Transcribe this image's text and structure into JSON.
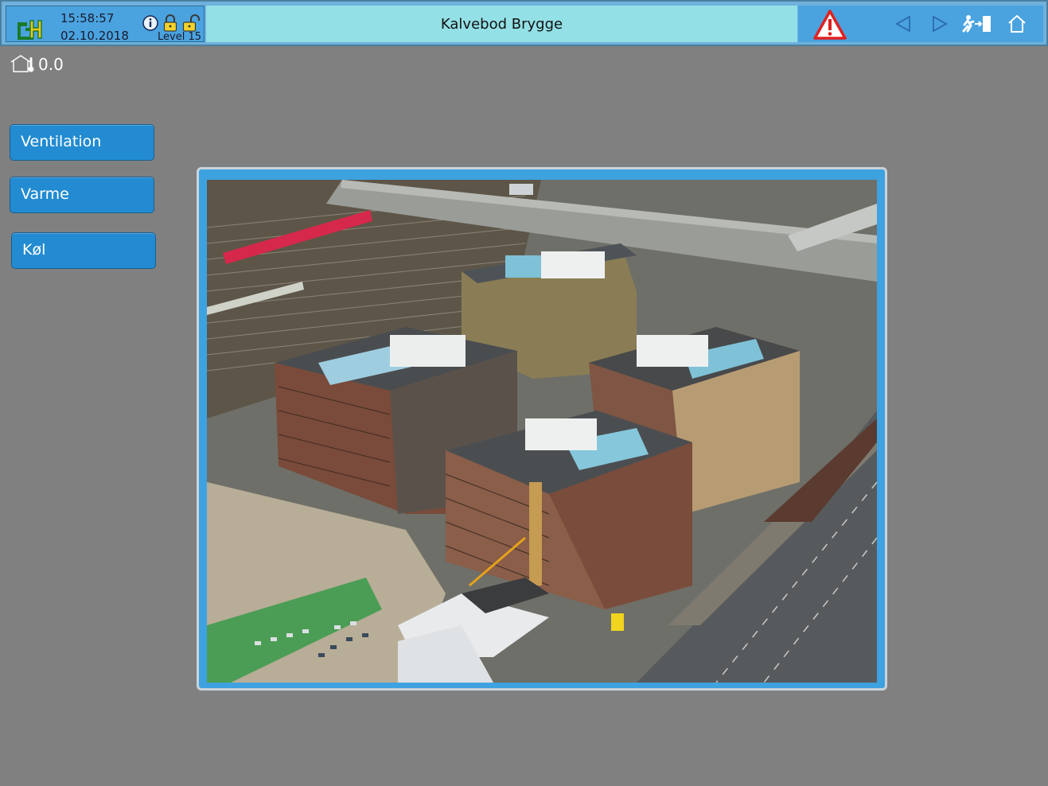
{
  "header": {
    "time": "15:58:57",
    "date": "02.10.2018",
    "level": "Level 15",
    "title": "Kalvebod Brygge",
    "icons": [
      "gh-logo-icon",
      "info-icon",
      "lock-icon",
      "unlock-icon",
      "alarm-warning-icon",
      "back-arrow-icon",
      "forward-arrow-icon",
      "exit-icon",
      "home-icon"
    ]
  },
  "status": {
    "temperature_value": "0.0",
    "icons": [
      "house-icon",
      "thermometer-icon"
    ]
  },
  "menu": {
    "items": [
      {
        "label": "Ventilation"
      },
      {
        "label": "Varme"
      },
      {
        "label": "Køl"
      }
    ]
  },
  "colors": {
    "background": "#808080",
    "title_band": "#93e0e6",
    "header_blue": "#4aa3df",
    "button_blue": "#228bd1",
    "frame_blue": "#3ea2e0",
    "alarm_red": "#e02020"
  }
}
